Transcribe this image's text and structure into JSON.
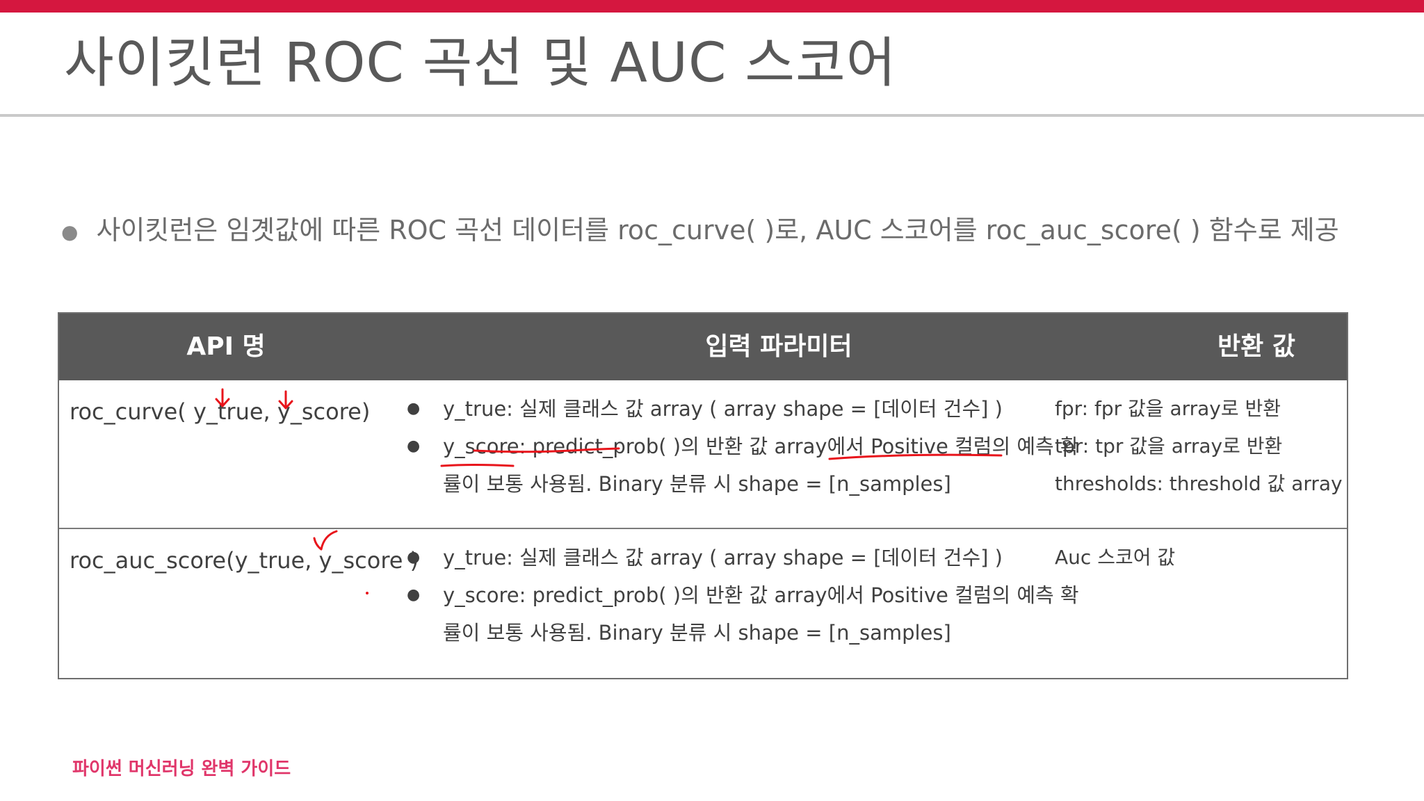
{
  "slide": {
    "title": "사이킷런 ROC 곡선 및 AUC 스코어",
    "bullet": "사이킷런은 임곗값에 따른 ROC 곡선 데이터를 roc_curve( )로, AUC 스코어를 roc_auc_score( ) 함수로 제공",
    "footer": "파이썬 머신러닝 완벽 가이드"
  },
  "table": {
    "headers": [
      "API 명",
      "입력 파라미터",
      "반환 값"
    ],
    "rows": [
      {
        "api": "roc_curve( y_true, y_score)",
        "params": [
          "y_true: 실제 클래스 값 array ( array shape = [데이터 건수] )",
          "y_score: predict_prob( )의 반환 값 array에서 Positive 컬럼의 예측 확",
          "률이 보통 사용됨. Binary 분류 시 shape = [n_samples]"
        ],
        "returns": [
          "fpr: fpr 값을 array로 반환",
          "tpr: tpr 값을 array로 반환",
          "thresholds: threshold 값 array"
        ]
      },
      {
        "api": "roc_auc_score(y_true, y_score )",
        "params": [
          "y_true: 실제 클래스 값 array ( array shape = [데이터 건수] )",
          "y_score: predict_prob( )의 반환 값 array에서 Positive 컬럼의 예측 확",
          "률이 보통 사용됨.  Binary 분류 시 shape = [n_samples]"
        ],
        "returns": [
          "Auc 스코어 값"
        ]
      }
    ]
  },
  "colors": {
    "accent_bar": "#d5173f",
    "header_bg": "#595959",
    "footer_text": "#e0366a",
    "annotation": "#e8141b"
  }
}
